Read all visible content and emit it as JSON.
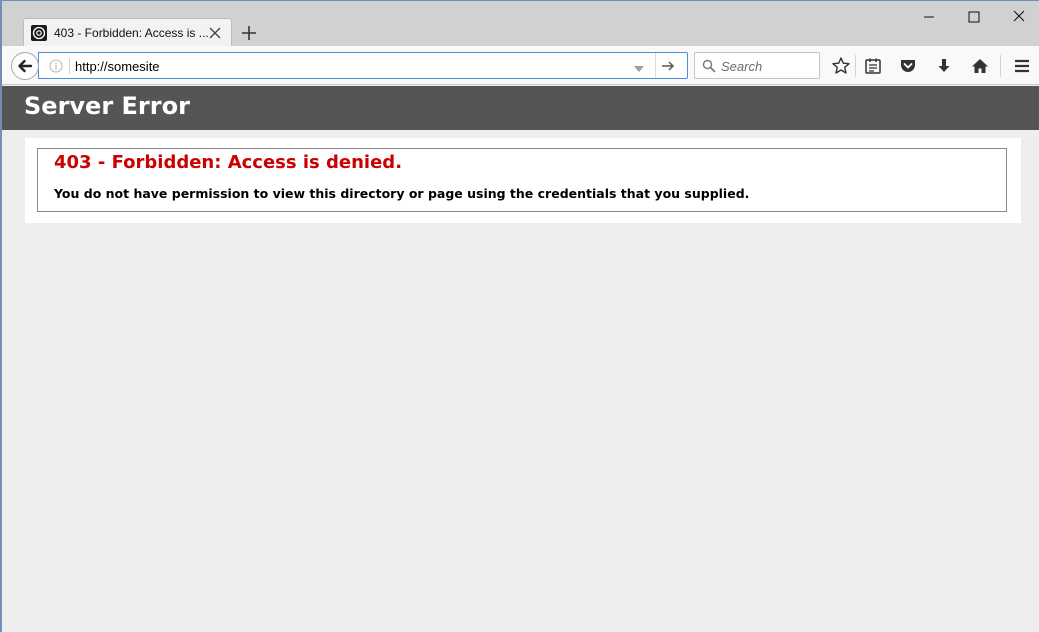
{
  "browser": {
    "tab": {
      "title": "403 - Forbidden: Access is ...",
      "favicon": "globe-icon"
    },
    "window_controls": [
      "minimize-icon",
      "maximize-icon",
      "close-icon"
    ],
    "urlbar": {
      "value": "http://somesite"
    },
    "searchbar": {
      "placeholder": "Search"
    },
    "toolbar_icons": [
      "bookmark-star-icon",
      "reading-list-icon",
      "pocket-icon",
      "download-icon",
      "home-icon",
      "menu-icon"
    ],
    "accent_color": "#4a90d9"
  },
  "page": {
    "header": {
      "title": "Server Error",
      "background": "#555555"
    },
    "error": {
      "heading": "403 - Forbidden: Access is denied.",
      "message": "You do not have permission to view this directory or page using the credentials that you supplied.",
      "heading_color": "#cc0000"
    }
  }
}
